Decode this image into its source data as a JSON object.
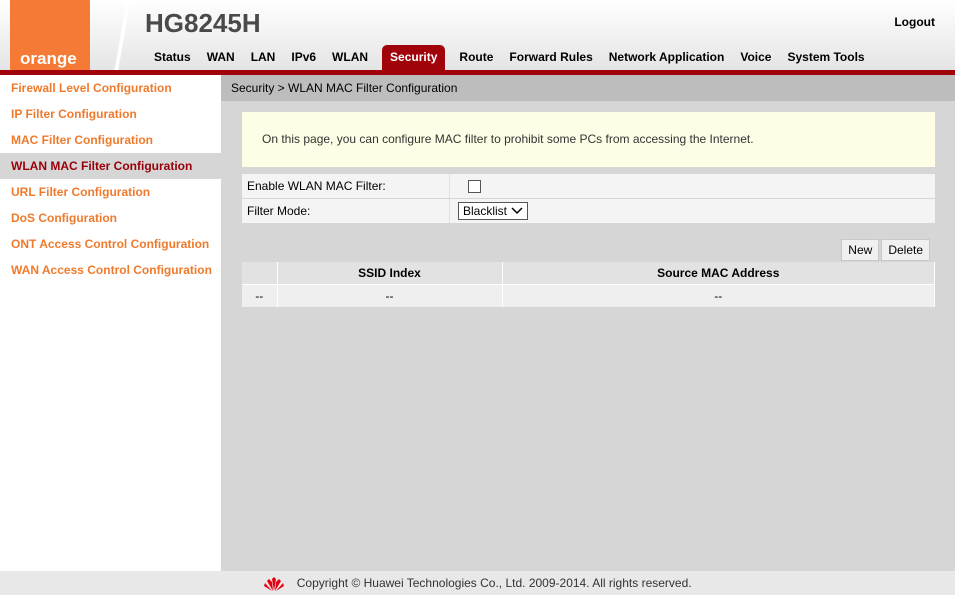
{
  "header": {
    "brand": "orange",
    "model": "HG8245H",
    "logout": "Logout"
  },
  "nav": [
    {
      "label": "Status"
    },
    {
      "label": "WAN"
    },
    {
      "label": "LAN"
    },
    {
      "label": "IPv6"
    },
    {
      "label": "WLAN"
    },
    {
      "label": "Security",
      "active": true
    },
    {
      "label": "Route"
    },
    {
      "label": "Forward Rules"
    },
    {
      "label": "Network Application"
    },
    {
      "label": "Voice"
    },
    {
      "label": "System Tools"
    }
  ],
  "sidebar": [
    {
      "label": "Firewall Level Configuration"
    },
    {
      "label": "IP Filter Configuration"
    },
    {
      "label": "MAC Filter Configuration"
    },
    {
      "label": "WLAN MAC Filter Configuration",
      "active": true
    },
    {
      "label": "URL Filter Configuration"
    },
    {
      "label": "DoS Configuration"
    },
    {
      "label": "ONT Access Control Configuration"
    },
    {
      "label": "WAN Access Control Configuration"
    }
  ],
  "breadcrumb": "Security > WLAN MAC Filter Configuration",
  "note": "On this page, you can configure MAC filter to prohibit some PCs from accessing the Internet.",
  "form": {
    "enable_label": "Enable WLAN MAC Filter:",
    "enable_checked": false,
    "mode_label": "Filter Mode:",
    "mode_value": "Blacklist"
  },
  "buttons": {
    "new": "New",
    "delete": "Delete"
  },
  "table": {
    "headers": [
      "",
      "SSID Index",
      "Source MAC Address"
    ],
    "rows": [
      [
        "--",
        "--",
        "--"
      ]
    ]
  },
  "footer": "Copyright © Huawei Technologies Co., Ltd. 2009-2014. All rights reserved.",
  "colors": {
    "accent": "#a0040a",
    "orange": "#f47a36"
  }
}
